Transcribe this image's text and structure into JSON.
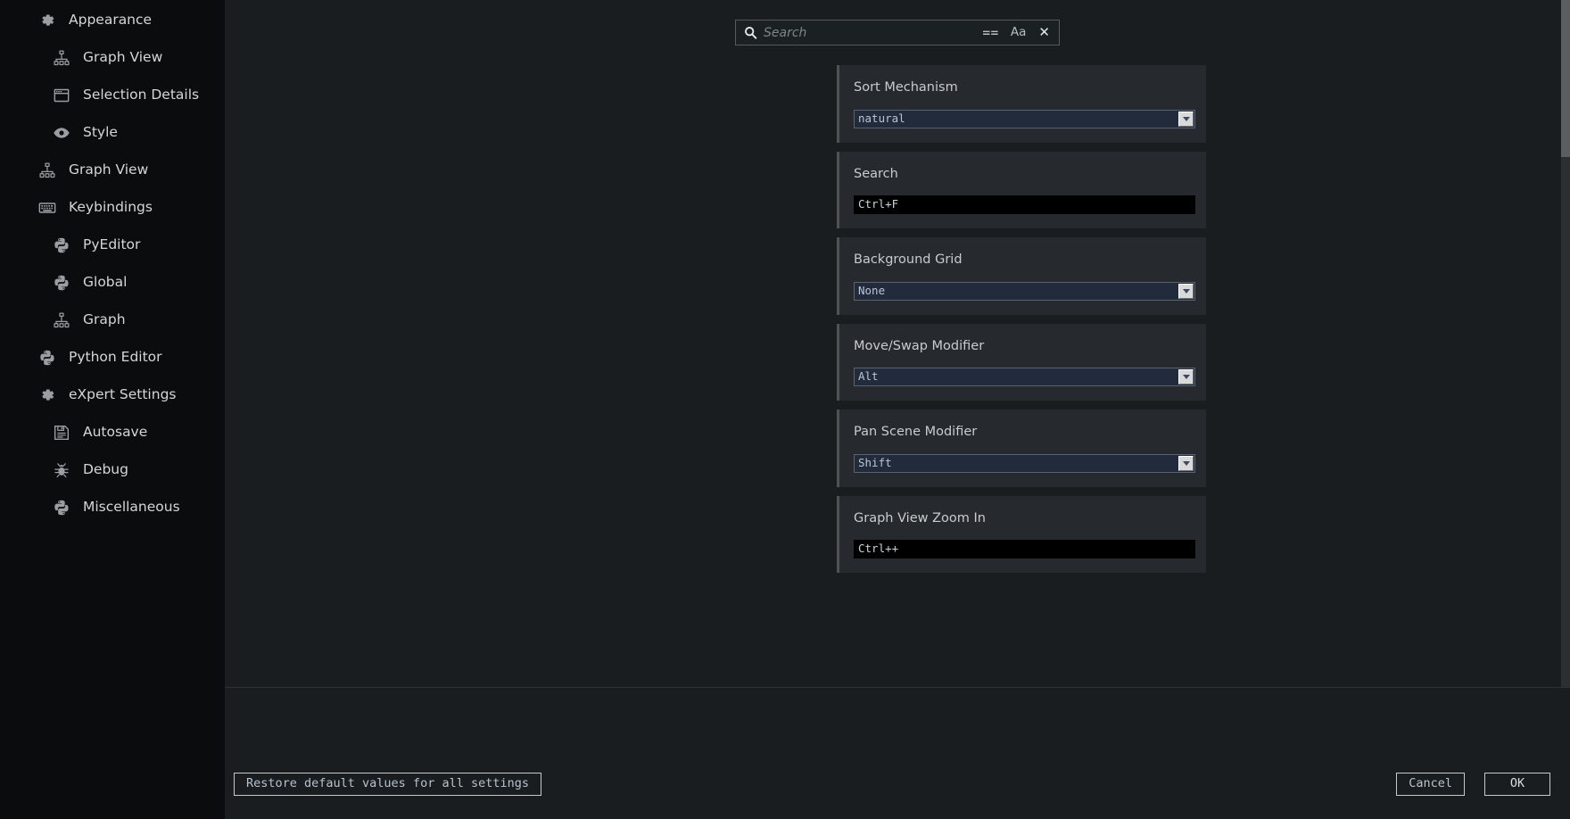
{
  "sidebar": {
    "items": [
      {
        "label": "Appearance",
        "icon": "gear-icon",
        "depth": 0
      },
      {
        "label": "Graph View",
        "icon": "graph-icon",
        "depth": 1
      },
      {
        "label": "Selection Details",
        "icon": "window-icon",
        "depth": 1
      },
      {
        "label": "Style",
        "icon": "eye-icon",
        "depth": 1
      },
      {
        "label": "Graph View",
        "icon": "graph-icon",
        "depth": 0
      },
      {
        "label": "Keybindings",
        "icon": "keyboard-icon",
        "depth": 0
      },
      {
        "label": "PyEditor",
        "icon": "python-icon",
        "depth": 1
      },
      {
        "label": "Global",
        "icon": "python-icon",
        "depth": 1
      },
      {
        "label": "Graph",
        "icon": "graph-icon",
        "depth": 1
      },
      {
        "label": "Python Editor",
        "icon": "python-icon",
        "depth": 0
      },
      {
        "label": "eXpert Settings",
        "icon": "gear-icon",
        "depth": 0
      },
      {
        "label": "Autosave",
        "icon": "save-icon",
        "depth": 1
      },
      {
        "label": "Debug",
        "icon": "bug-icon",
        "depth": 1
      },
      {
        "label": "Miscellaneous",
        "icon": "python-icon",
        "depth": 1
      }
    ]
  },
  "search": {
    "value": "",
    "placeholder": "Search",
    "exact_match_label": "==",
    "case_sensitive_label": "Aa",
    "clear_label": "✕"
  },
  "settings": [
    {
      "label": "Sort Mechanism",
      "type": "combo",
      "value": "natural"
    },
    {
      "label": "Search",
      "type": "key",
      "value": "Ctrl+F"
    },
    {
      "label": "Background Grid",
      "type": "combo",
      "value": "None"
    },
    {
      "label": "Move/Swap Modifier",
      "type": "combo",
      "value": "Alt"
    },
    {
      "label": "Pan Scene Modifier",
      "type": "combo",
      "value": "Shift"
    },
    {
      "label": "Graph View Zoom In",
      "type": "key",
      "value": "Ctrl++"
    }
  ],
  "footer": {
    "restore_label": "Restore default values for all settings",
    "cancel_label": "Cancel",
    "ok_label": "OK"
  }
}
